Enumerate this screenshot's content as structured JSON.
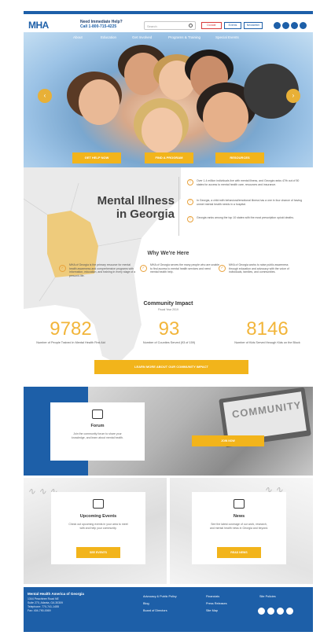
{
  "header": {
    "logo_text": "MHA",
    "logo_sub": "Mental Health America of Georgia",
    "help_line1": "Need Immediate Help?",
    "help_line2": "Call 1-800-715-4225",
    "search_placeholder": "Search",
    "buttons": [
      "Donate",
      "Events",
      "Newsletter"
    ],
    "social_icons": [
      "facebook-icon",
      "twitter-icon",
      "instagram-icon",
      "linkedin-icon"
    ],
    "brand_color": "#1d5fa8",
    "accent_color": "#f2b41b"
  },
  "hero": {
    "nav": [
      "About",
      "Education",
      "Get Involved",
      "Programs & Training",
      "Special Events"
    ],
    "buttons": [
      "GET HELP NOW",
      "FIND A PROGRAM",
      "RESOURCES"
    ]
  },
  "mental_illness": {
    "title_line1": "Mental Illness",
    "title_line2": "in Georgia",
    "facts": [
      "Over 1.4 million individuals live with mental illness, and Georgia ranks 47th out of 50 states for access to mental health care, resources and insurance.",
      "In Georgia, a child with behavioral/emotional illness has a one in four chance of having unmet mental health needs in a hospital.",
      "Georgia ranks among the top 10 states with the most prescription opioid deaths."
    ]
  },
  "why": {
    "title": "Why We're Here",
    "items": [
      "MHA of Georgia is the primary resource for mental health awareness and comprehensive programs with information, education, and training in every stage of a person's life.",
      "MHA of Georgia serves the many people who are unable to find access to mental health services and need mental health help.",
      "MHA of Georgia works to raise public awareness through education and advocacy with the voice of individuals, families, and communities."
    ]
  },
  "impact": {
    "title": "Community Impact",
    "subtitle": "Fiscal Year 2019",
    "stats": [
      {
        "value": "9782",
        "label": "Number of People Trained in Mental Health First Aid"
      },
      {
        "value": "93",
        "label": "Number of Counties Served (93 of 159)"
      },
      {
        "value": "8146",
        "label": "Number of Kids Served through Kids on the Block"
      }
    ],
    "button": "LEARN MORE ABOUT OUR COMMUNITY IMPACT"
  },
  "forum": {
    "title": "Forum",
    "description": "Join the community forum to share your knowledge, and learn about mental health.",
    "photo_word": "COMMUNITY",
    "button": "JOIN NOW"
  },
  "events": {
    "title": "Upcoming Events",
    "description": "Check out upcoming events in your area to meet with and help your community.",
    "button": "SEE EVENTS"
  },
  "news": {
    "title": "News",
    "description": "See the latest coverage of our work, research, and mental health news in Georgia and beyond.",
    "button": "READ NEWS"
  },
  "footer": {
    "title": "Mental Health America of Georgia",
    "address": [
      "1344 Peachtree Road NE",
      "Suite 270, Atlanta, GA 30309",
      "Telephone: 770-741-1455",
      "Fax: 404-790-0069"
    ],
    "col1": [
      "Advocacy & Public Policy",
      "Blog",
      "Board of Directors"
    ],
    "col2": [
      "Financials",
      "Press Releases",
      "Site Map"
    ],
    "col3": [
      "Site Policies"
    ],
    "social_icons": [
      "twitter-icon",
      "facebook-icon",
      "instagram-icon",
      "rss-icon"
    ]
  }
}
